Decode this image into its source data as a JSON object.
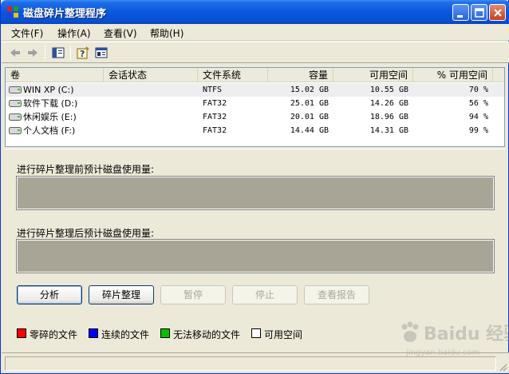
{
  "window": {
    "title": "磁盘碎片整理程序"
  },
  "menu": [
    "文件(F)",
    "操作(A)",
    "查看(V)",
    "帮助(H)"
  ],
  "toolbar": {
    "icons": [
      "back-arrow-icon",
      "forward-arrow-icon",
      "show-hide-console-tree-icon",
      "help-icon",
      "properties-icon"
    ]
  },
  "volumes": {
    "headers": [
      "卷",
      "会话状态",
      "文件系统",
      "容量",
      "可用空间",
      "% 可用空间"
    ],
    "rows": [
      {
        "name": "WIN XP (C:)",
        "status": "",
        "fs": "NTFS",
        "capacity": "15.02 GB",
        "free": "10.55 GB",
        "pct": "70 %"
      },
      {
        "name": "软件下载 (D:)",
        "status": "",
        "fs": "FAT32",
        "capacity": "25.01 GB",
        "free": "14.26 GB",
        "pct": "56 %"
      },
      {
        "name": "休闲娱乐 (E:)",
        "status": "",
        "fs": "FAT32",
        "capacity": "20.01 GB",
        "free": "18.96 GB",
        "pct": "94 %"
      },
      {
        "name": "个人文档 (F:)",
        "status": "",
        "fs": "FAT32",
        "capacity": "14.44 GB",
        "free": "14.31 GB",
        "pct": "99 %"
      }
    ]
  },
  "usage": {
    "before_label": "进行碎片整理前预计磁盘使用量:",
    "after_label": "进行碎片整理后预计磁盘使用量:"
  },
  "buttons": {
    "analyze": "分析",
    "defrag": "碎片整理",
    "pause": "暂停",
    "stop": "停止",
    "report": "查看报告"
  },
  "legend": [
    {
      "label": "零碎的文件",
      "color": "#ff0000"
    },
    {
      "label": "连续的文件",
      "color": "#0000ff"
    },
    {
      "label": "无法移动的文件",
      "color": "#00c000"
    },
    {
      "label": "可用空间",
      "color": "#ffffff"
    }
  ],
  "watermark": {
    "text": "Baidu 经验",
    "sub": "jingyan.baidu.com"
  }
}
